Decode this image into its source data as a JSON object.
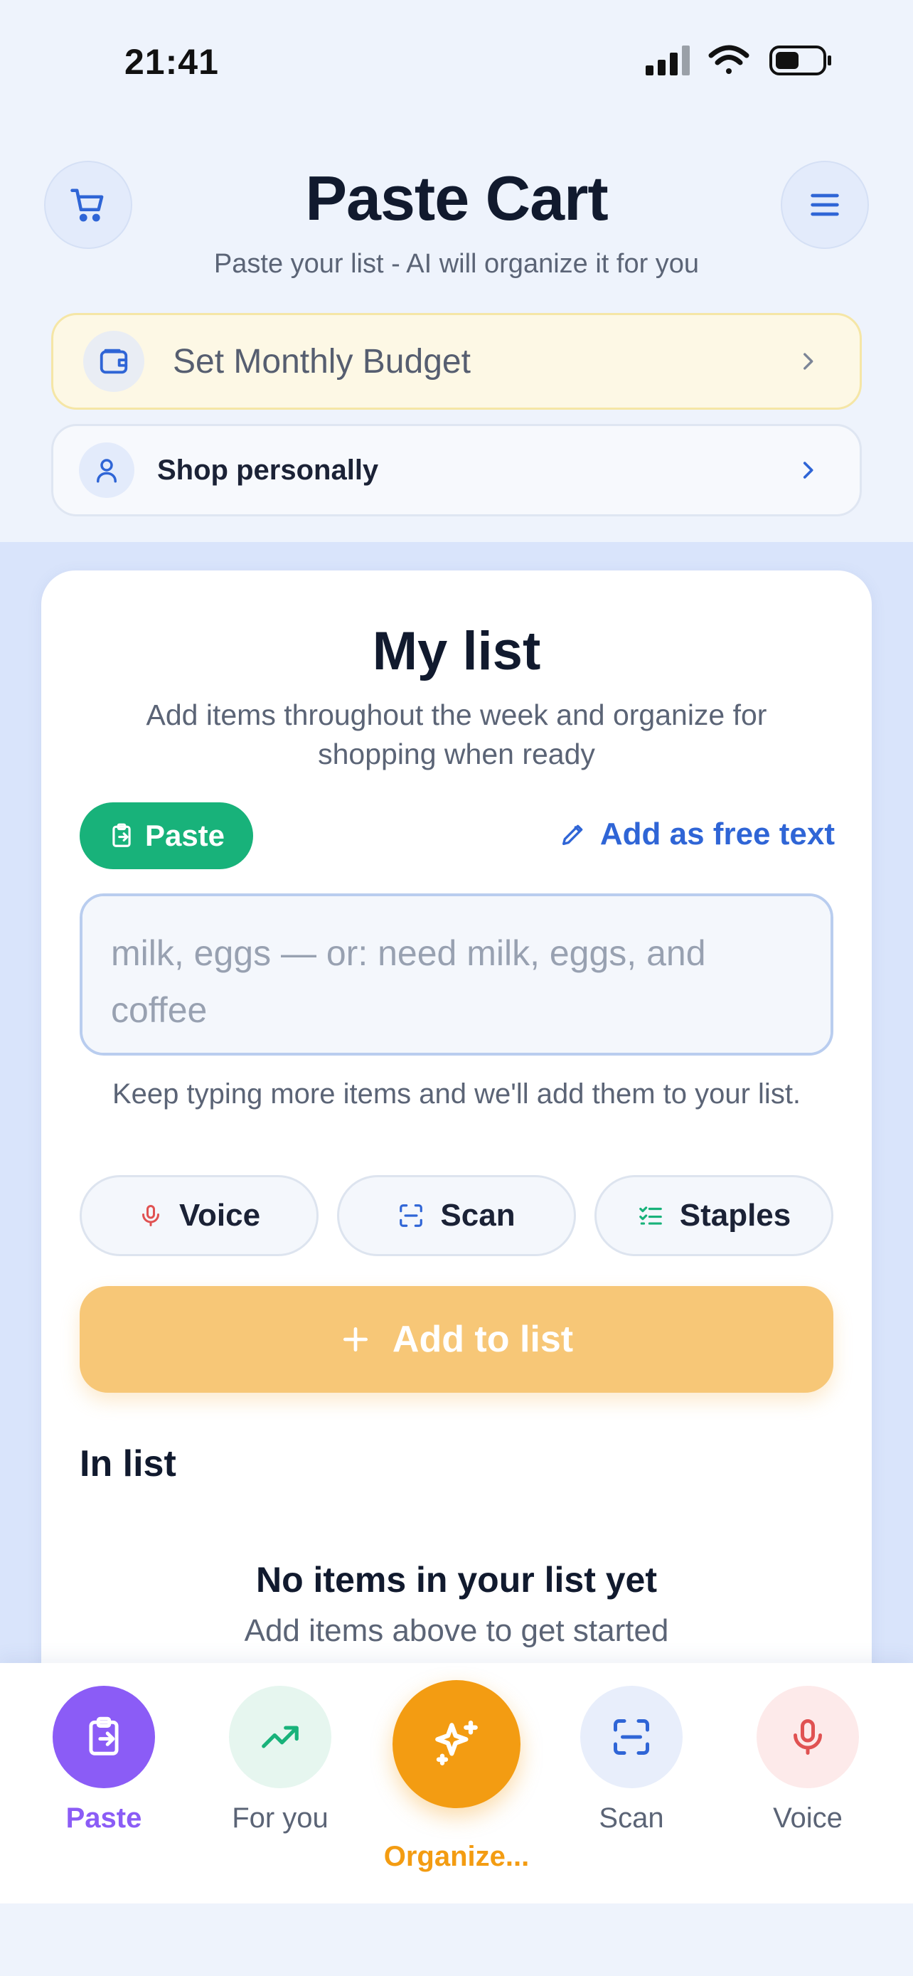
{
  "status_bar": {
    "time": "21:41"
  },
  "header": {
    "title": "Paste Cart",
    "subtitle": "Paste your list - AI will organize it for you",
    "left_icon": "cart-icon",
    "right_icon": "menu-icon"
  },
  "budget": {
    "label": "Set Monthly Budget",
    "icon": "wallet-icon"
  },
  "shop": {
    "label": "Shop personally",
    "icon": "user-icon"
  },
  "card": {
    "title": "My list",
    "description": "Add items throughout the week and organize for shopping when ready",
    "paste_chip": "Paste",
    "free_text_link": "Add as free text",
    "input_placeholder": "milk, eggs — or: need milk, eggs, and coffee",
    "hint": "Keep typing more items and we'll add them to your list.",
    "quick_buttons": [
      {
        "label": "Voice",
        "icon": "mic-icon"
      },
      {
        "label": "Scan",
        "icon": "scan-icon"
      },
      {
        "label": "Staples",
        "icon": "checklist-icon"
      }
    ],
    "add_button": "Add to list",
    "in_list_label": "In list",
    "empty_title": "No items in your list yet",
    "empty_subtitle": "Add items above to get started"
  },
  "bottom_nav": [
    {
      "label": "Paste",
      "icon": "clipboard-icon",
      "active": true
    },
    {
      "label": "For you",
      "icon": "trending-up-icon"
    },
    {
      "label": "Organize...",
      "icon": "sparkles-icon"
    },
    {
      "label": "Scan",
      "icon": "scan-icon"
    },
    {
      "label": "Voice",
      "icon": "mic-icon"
    }
  ],
  "colors": {
    "accent_blue": "#2f65d6",
    "paste_green": "#18b27a",
    "add_button": "#f7c777",
    "organize_orange": "#f39c12",
    "paste_purple": "#8b5cf6",
    "voice_red": "#e05252"
  }
}
